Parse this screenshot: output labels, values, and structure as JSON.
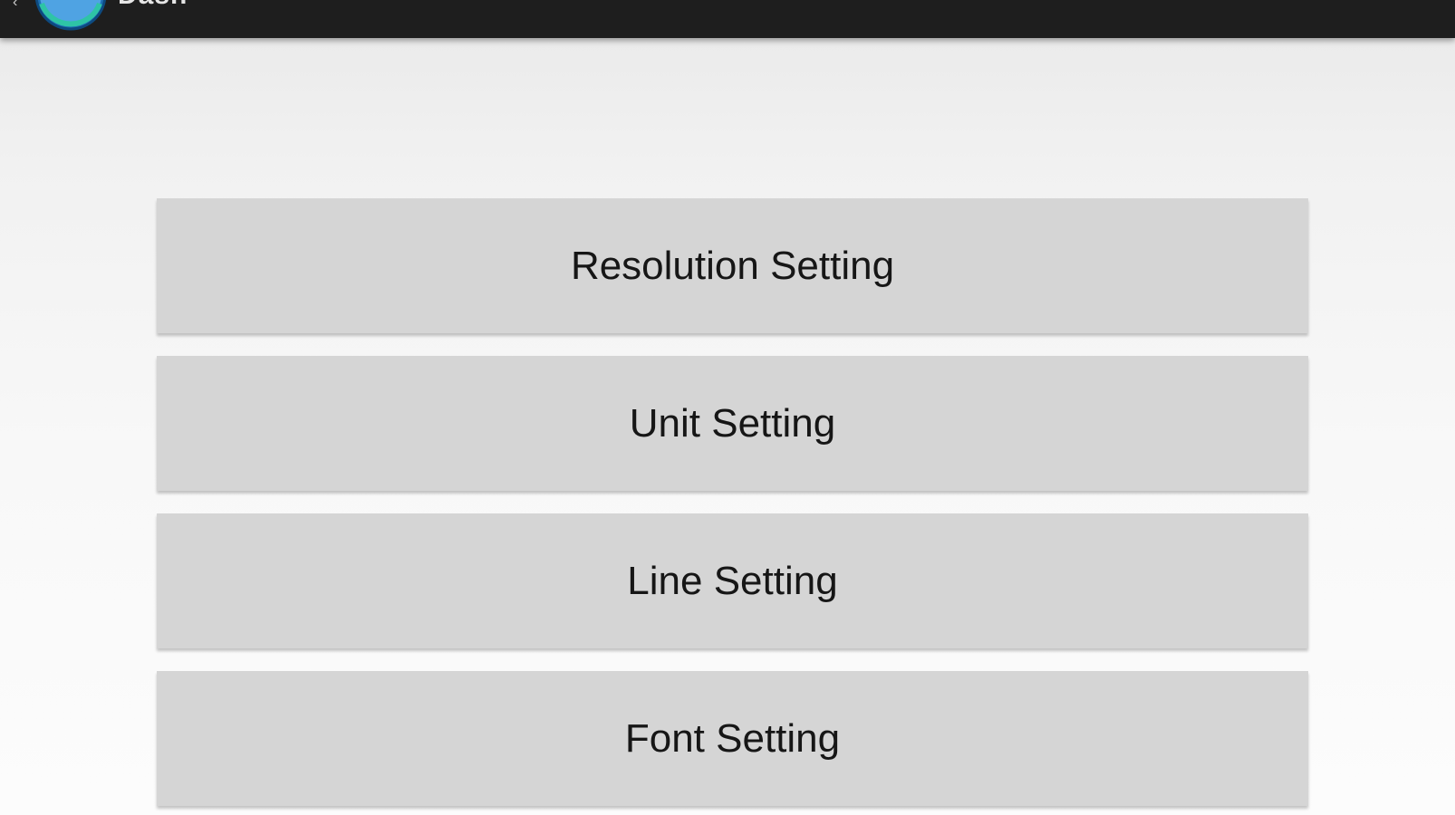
{
  "action_bar": {
    "title": "Dash",
    "up_icon": "chevron-left-icon",
    "app_icon": "app-logo-icon",
    "background": "#1e1e1e"
  },
  "settings": {
    "buttons": [
      {
        "label": "Resolution Setting"
      },
      {
        "label": "Unit Setting"
      },
      {
        "label": "Line Setting"
      },
      {
        "label": "Font Setting"
      }
    ],
    "button_color": "#d5d5d5",
    "text_color": "#161616"
  }
}
